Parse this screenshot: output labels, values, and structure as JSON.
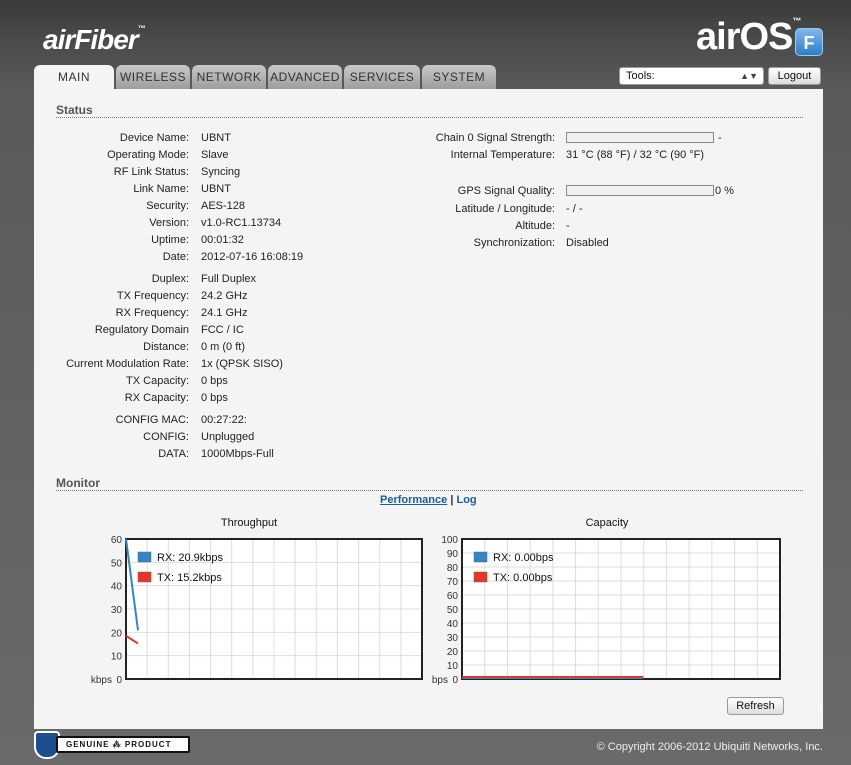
{
  "header": {
    "brand_left": "airFiber",
    "brand_left_tm": "™",
    "brand_right": "airOS",
    "brand_right_tm": "™",
    "brand_badge": "F"
  },
  "tabs": [
    {
      "label": "MAIN",
      "active": true
    },
    {
      "label": "WIRELESS",
      "active": false
    },
    {
      "label": "NETWORK",
      "active": false
    },
    {
      "label": "ADVANCED",
      "active": false
    },
    {
      "label": "SERVICES",
      "active": false
    },
    {
      "label": "SYSTEM",
      "active": false
    }
  ],
  "toolbar": {
    "tools_selected": "Tools:",
    "logout_label": "Logout"
  },
  "status": {
    "title": "Status",
    "left": [
      {
        "label": "Device Name:",
        "value": "UBNT"
      },
      {
        "label": "Operating Mode:",
        "value": "Slave"
      },
      {
        "label": "RF Link Status:",
        "value": "Syncing"
      },
      {
        "label": "Link Name:",
        "value": "UBNT"
      },
      {
        "label": "Security:",
        "value": "AES-128"
      },
      {
        "label": "Version:",
        "value": "v1.0-RC1.13734"
      },
      {
        "label": "Uptime:",
        "value": "00:01:32"
      },
      {
        "label": "Date:",
        "value": "2012-07-16 16:08:19"
      },
      {
        "label": "Duplex:",
        "value": "Full Duplex"
      },
      {
        "label": "TX Frequency:",
        "value": "24.2 GHz"
      },
      {
        "label": "RX Frequency:",
        "value": "24.1 GHz"
      },
      {
        "label": "Regulatory Domain",
        "value": "FCC / IC"
      },
      {
        "label": "Distance:",
        "value": "0 m (0 ft)"
      },
      {
        "label": "Current Modulation Rate:",
        "value": "1x (QPSK SISO)"
      },
      {
        "label": "TX Capacity:",
        "value": "0 bps"
      },
      {
        "label": "RX Capacity:",
        "value": "0 bps"
      },
      {
        "label": "CONFIG MAC:",
        "value": "00:27:22:"
      },
      {
        "label": "CONFIG:",
        "value": "Unplugged"
      },
      {
        "label": "DATA:",
        "value": "1000Mbps-Full"
      }
    ],
    "right": {
      "chain0": {
        "label": "Chain 0 Signal Strength:",
        "value": "-"
      },
      "temperature": {
        "label": "Internal Temperature:",
        "value": "31 °C (88 °F) / 32 °C (90 °F)"
      },
      "gps": {
        "label": "GPS Signal Quality:",
        "value": "0 %",
        "fraction": 0
      },
      "latlon": {
        "label": "Latitude / Longitude:",
        "value": "- / -"
      },
      "altitude": {
        "label": "Altitude:",
        "value": "-"
      },
      "sync": {
        "label": "Synchronization:",
        "value": "Disabled"
      }
    }
  },
  "monitor": {
    "title": "Monitor",
    "links": {
      "performance": "Performance",
      "separator": "|",
      "log": "Log"
    },
    "refresh_label": "Refresh"
  },
  "chart_data": [
    {
      "type": "line",
      "title": "Throughput",
      "ylabel": "kbps",
      "ylim": [
        0,
        60
      ],
      "yticks": [
        0,
        10,
        20,
        30,
        40,
        50,
        60
      ],
      "legend_position": "top-left",
      "grid": true,
      "series": [
        {
          "name": "RX: 20.9kbps",
          "color": "#2f86c9",
          "values": [
            60,
            20.9
          ]
        },
        {
          "name": "TX: 15.2kbps",
          "color": "#e8352a",
          "values": [
            18.5,
            15.2
          ]
        }
      ]
    },
    {
      "type": "line",
      "title": "Capacity",
      "ylabel": "bps",
      "ylim": [
        0,
        100
      ],
      "yticks": [
        0,
        10,
        20,
        30,
        40,
        50,
        60,
        70,
        80,
        90,
        100
      ],
      "legend_position": "top-left",
      "grid": true,
      "series": [
        {
          "name": "RX: 0.00bps",
          "color": "#2f86c9",
          "values": [
            0,
            0
          ]
        },
        {
          "name": "TX: 0.00bps",
          "color": "#e8352a",
          "values": [
            0,
            0
          ]
        }
      ]
    }
  ],
  "footer": {
    "genuine_label": "GENUINE ⁂ PRODUCT",
    "copyright": "© Copyright 2006-2012 Ubiquiti Networks, Inc."
  }
}
